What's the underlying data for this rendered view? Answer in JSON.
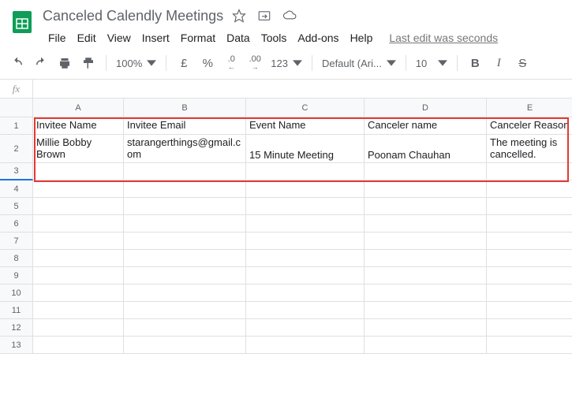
{
  "doc_title": "Canceled Calendly Meetings",
  "menu": [
    "File",
    "Edit",
    "View",
    "Insert",
    "Format",
    "Data",
    "Tools",
    "Add-ons",
    "Help"
  ],
  "last_edit": "Last edit was seconds",
  "toolbar": {
    "zoom": "100%",
    "currency": "£",
    "percent": "%",
    "dec_dec": ".0",
    "inc_dec": ".00",
    "numfmt": "123",
    "font": "Default (Ari...",
    "font_size": "10"
  },
  "fx_label": "fx",
  "columns": [
    "A",
    "B",
    "C",
    "D",
    "E"
  ],
  "rows": [
    "1",
    "2",
    "3",
    "4",
    "5",
    "6",
    "7",
    "8",
    "9",
    "10",
    "11",
    "12",
    "13"
  ],
  "headers": {
    "A": "Invitee Name",
    "B": "Invitee Email",
    "C": "Event Name",
    "D": "Canceler name",
    "E": "Canceler Reason"
  },
  "data_row": {
    "A": "Millie Bobby Brown",
    "B": "starangerthings@gmail.com",
    "C": "15 Minute Meeting",
    "D": "Poonam Chauhan",
    "E": "The meeting is cancelled."
  }
}
